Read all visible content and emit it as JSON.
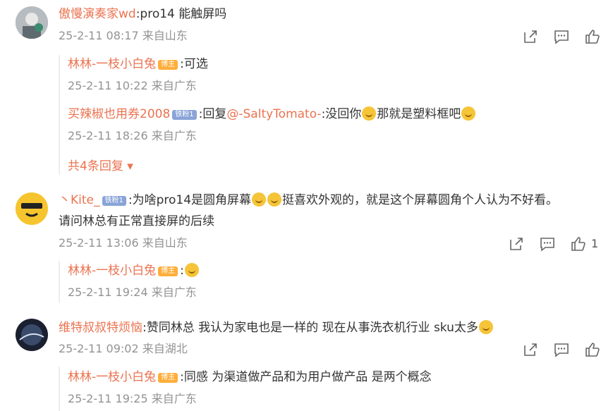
{
  "comments": [
    {
      "user": "傲慢演奏家wd",
      "text": ":pro14 能触屏吗",
      "meta": "25-2-11 08:17 来自山东",
      "replies": [
        {
          "user": "林林-一枝小白兔",
          "badge": "博主",
          "text": ":可选",
          "meta": "25-2-11 10:22 来自广东"
        },
        {
          "user": "买辣椒也用券2008",
          "badge": "铁粉1",
          "text_prefix": ":回复",
          "mention": "@-SaltyTomato-",
          "text_suffix": ":没回你",
          "text_tail": "那就是塑料框吧",
          "meta": "25-2-11 18:26 来自广东"
        }
      ],
      "more_label": "共4条回复 ▾"
    },
    {
      "user": "丶Kite_",
      "badge": "铁粉1",
      "text": ":为啥pro14是圆角屏幕",
      "text2": "挺喜欢外观的，就是这个屏幕圆角个人认为不好看。",
      "text3": "请问林总有正常直接屏的后续",
      "meta": "25-2-11 13:06 来自山东",
      "likes": "1",
      "replies": [
        {
          "user": "林林-一枝小白兔",
          "badge": "博主",
          "text": ":",
          "meta": "25-2-11 19:24 来自广东"
        }
      ]
    },
    {
      "user": "维特叔叔特烦恼",
      "text": ":赞同林总 我认为家电也是一样的 现在从事洗衣机行业 sku太多",
      "meta": "25-2-11 09:02 来自湖北",
      "replies": [
        {
          "user": "林林-一枝小白兔",
          "badge": "博主",
          "text": ":同感 为渠道做产品和为用户做产品 是两个概念",
          "meta": "25-2-11 19:25 来自广东"
        }
      ]
    }
  ],
  "icons": [
    "share-icon",
    "comment-icon",
    "like-icon"
  ]
}
